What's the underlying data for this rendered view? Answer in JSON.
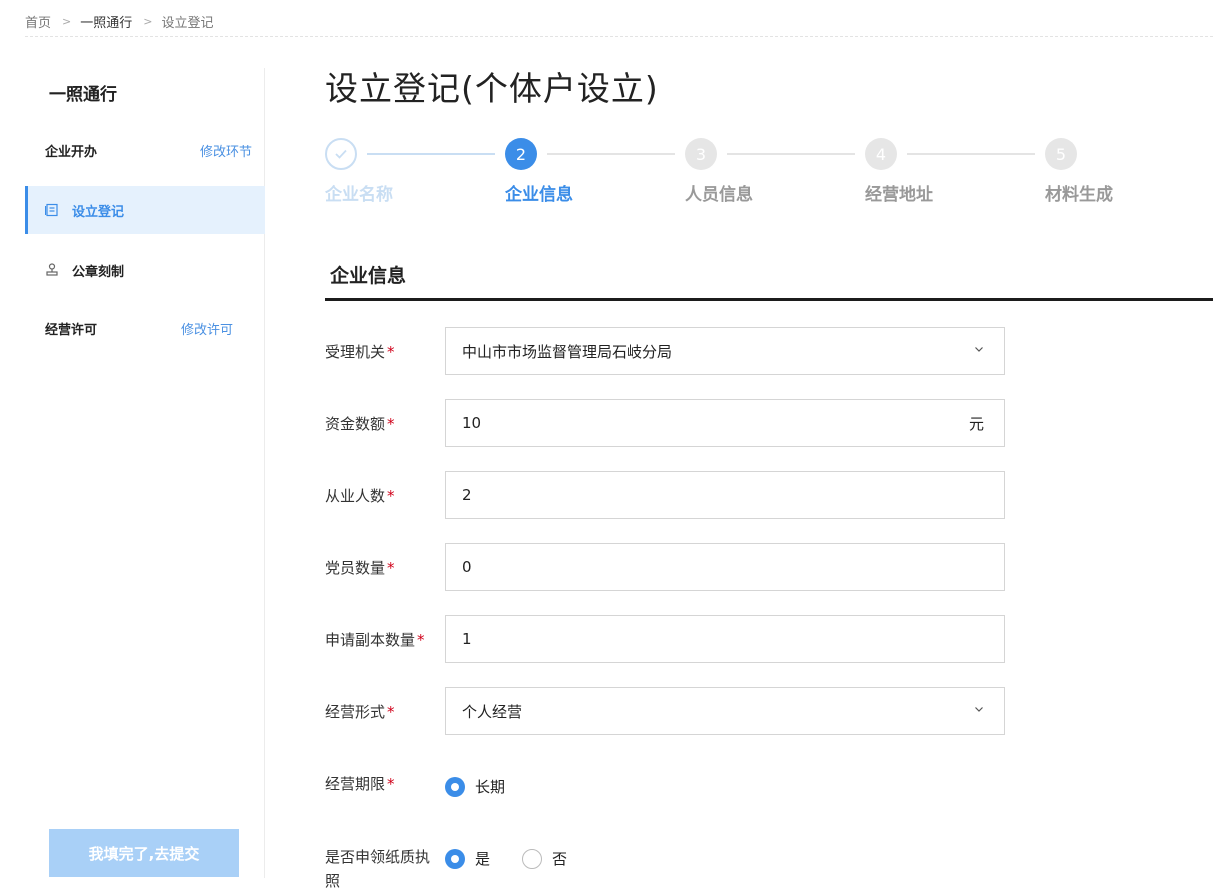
{
  "breadcrumb": {
    "home": "首页",
    "section": "一照通行",
    "current": "设立登记"
  },
  "sidebar": {
    "title": "一照通行",
    "groups": [
      {
        "label": "企业开办",
        "link": "修改环节"
      },
      {
        "label": "经营许可",
        "link": "修改许可"
      }
    ],
    "items": [
      {
        "label": "设立登记",
        "icon": "form-icon",
        "active": true
      },
      {
        "label": "公章刻制",
        "icon": "stamp-icon",
        "active": false
      }
    ],
    "submit_label": "我填完了,去提交"
  },
  "main": {
    "title": "设立登记(个体户设立)",
    "steps": [
      {
        "number": "1",
        "label": "企业名称",
        "state": "done",
        "icon": "check-icon"
      },
      {
        "number": "2",
        "label": "企业信息",
        "state": "active"
      },
      {
        "number": "3",
        "label": "人员信息",
        "state": "todo"
      },
      {
        "number": "4",
        "label": "经营地址",
        "state": "todo"
      },
      {
        "number": "5",
        "label": "材料生成",
        "state": "todo"
      }
    ],
    "section_title": "企业信息",
    "form": {
      "authority": {
        "label": "受理机关",
        "value": "中山市市场监督管理局石岐分局",
        "icon": "chevron-down-icon"
      },
      "capital": {
        "label": "资金数额",
        "value": "10",
        "suffix": "元"
      },
      "employees": {
        "label": "从业人数",
        "value": "2"
      },
      "party_members": {
        "label": "党员数量",
        "value": "0"
      },
      "copies": {
        "label": "申请副本数量",
        "value": "1"
      },
      "business_form": {
        "label": "经营形式",
        "value": "个人经营",
        "icon": "chevron-down-icon"
      },
      "term": {
        "label": "经营期限",
        "option": "长期",
        "selected": true
      },
      "paper_license": {
        "label": "是否申领纸质执照",
        "options": [
          "是",
          "否"
        ],
        "selected": "是"
      }
    },
    "required_mark": "*"
  },
  "colors": {
    "accent": "#3b8de8",
    "accent_light": "#e5f1fd",
    "required": "#d0021b",
    "step_done": "#c9def3",
    "submit_bg": "#a9d0f7"
  }
}
